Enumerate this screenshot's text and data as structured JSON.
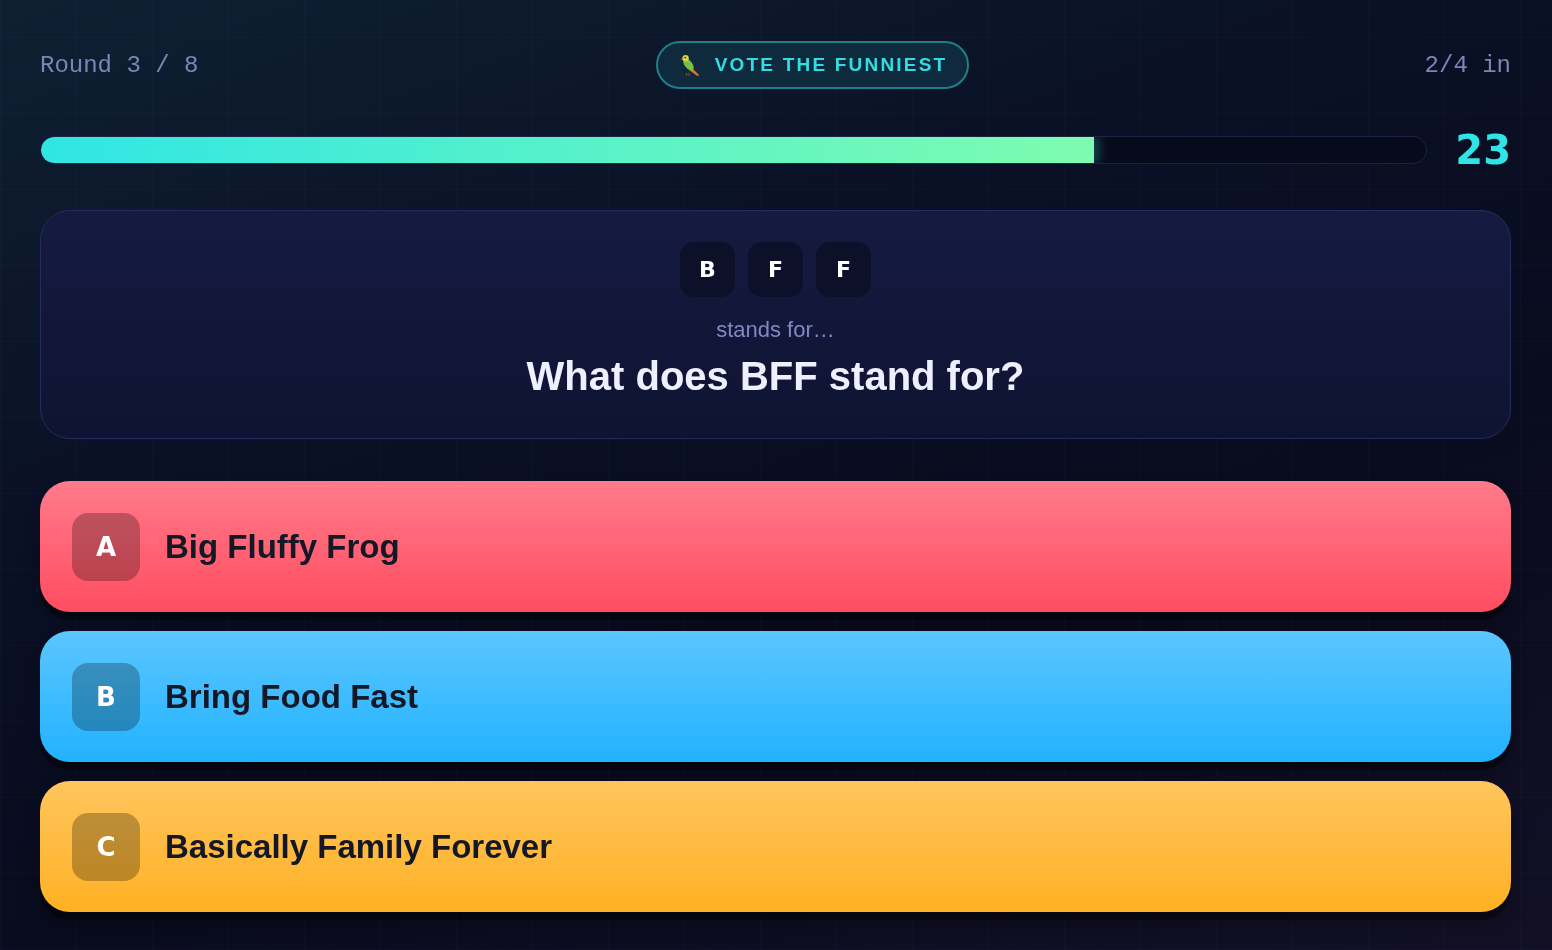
{
  "header": {
    "round": "Round 3 / 8",
    "phase": "VOTE THE FUNNIEST",
    "answered": "2/4 in"
  },
  "timer": {
    "level": 0.76,
    "seconds": "23"
  },
  "question": {
    "letters": [
      "B",
      "F",
      "F"
    ],
    "hint": "stands for…",
    "text": "What does BFF stand for?"
  },
  "answers": [
    {
      "letter": "A",
      "text": "Big Fluffy Frog",
      "color": "#ff4d61",
      "selected": false
    },
    {
      "letter": "B",
      "text": "Bring Food Fast",
      "color": "#22b2ff",
      "selected": false
    },
    {
      "letter": "C",
      "text": "Basically Family Forever",
      "color": "#ffb124",
      "selected": false
    }
  ]
}
